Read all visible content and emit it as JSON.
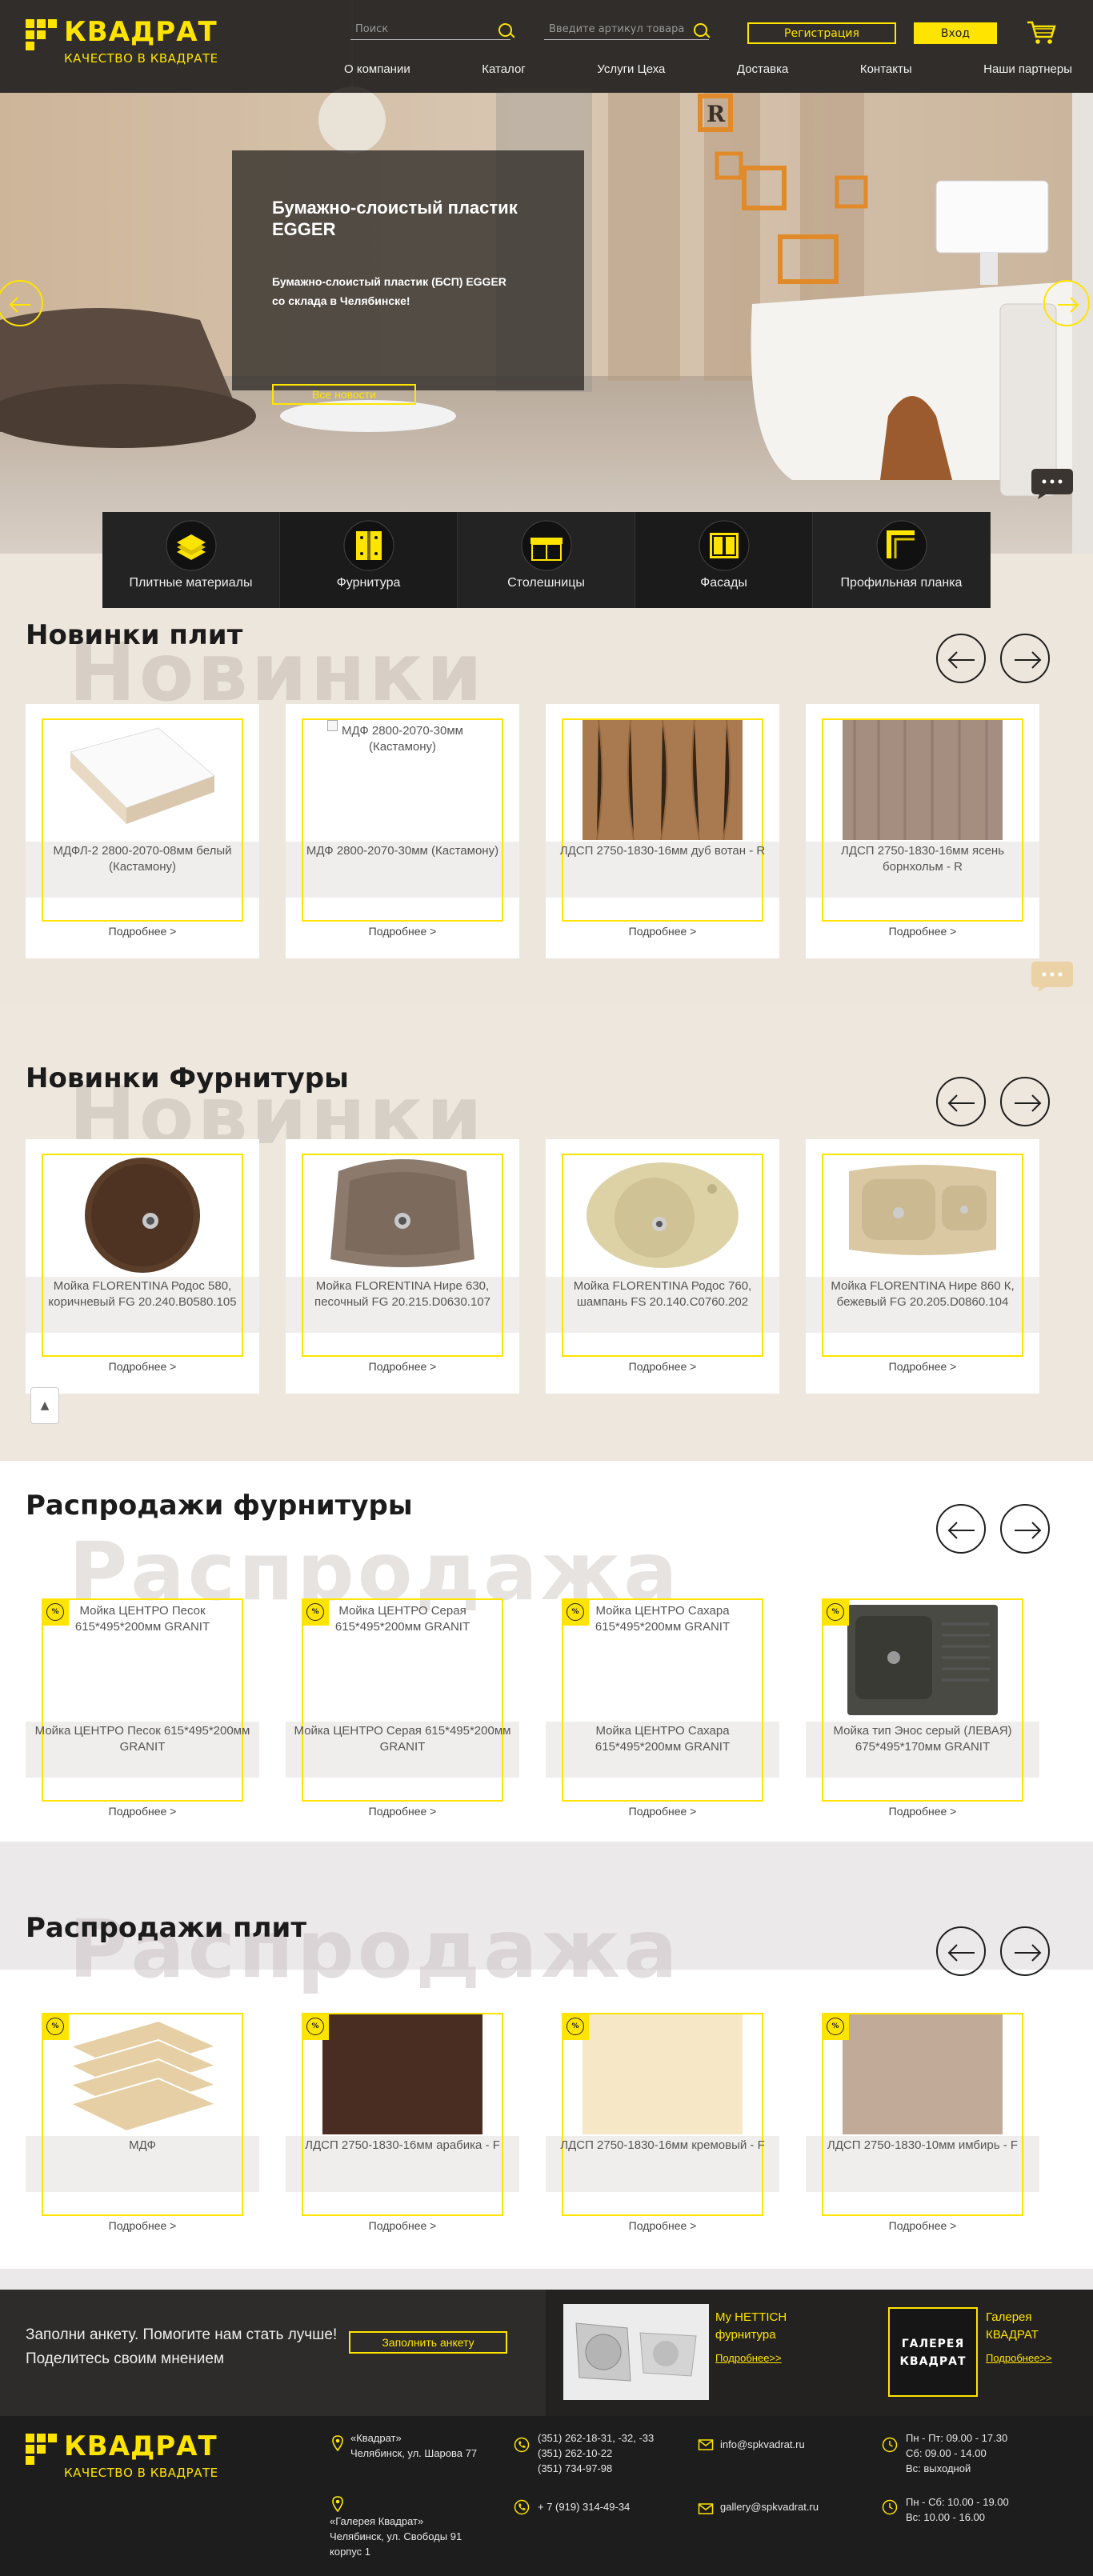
{
  "header": {
    "logo_name": "КВАДРАТ",
    "logo_slogan": "КАЧЕСТВО В КВАДРАТЕ",
    "search_placeholder": "Поиск",
    "article_placeholder": "Введите артикул товара",
    "register_label": "Регистрация",
    "login_label": "Вход",
    "nav": [
      "О компании",
      "Каталог",
      "Услуги Цеха",
      "Доставка",
      "Контакты",
      "Наши партнеры"
    ]
  },
  "hero": {
    "title": "Бумажно-слоистый пластик EGGER",
    "text": "Бумажно-слоистый пластик (БСП) EGGER со склада в Челябинске!",
    "button": "Все новости",
    "sign_letter": "R",
    "chat_label": "···"
  },
  "categories": [
    "Плитные материалы",
    "Фурнитура",
    "Столешницы",
    "Фасады",
    "Профильная планка"
  ],
  "more_label": "Подробнее >",
  "sale_badge_label": "%",
  "up_label": "▲",
  "sections": {
    "new_plates": {
      "title": "Новинки плит",
      "ghost": "Новинки",
      "items": [
        {
          "name": "МДФЛ-2 2800-2070-08мм белый (Кастамону)",
          "caption": ""
        },
        {
          "name": "МДФ 2800-2070-30мм (Кастамону)",
          "caption": "МДФ 2800-2070-30мм (Кастамону)"
        },
        {
          "name": "ЛДСП 2750-1830-16мм дуб вотан - R",
          "caption": ""
        },
        {
          "name": "ЛДСП 2750-1830-16мм ясень борнхольм - R",
          "caption": ""
        }
      ]
    },
    "new_fittings": {
      "title": "Новинки Фурнитуры",
      "ghost": "Новинки",
      "items": [
        {
          "name": "Мойка FLORENTINA Родос 580, коричневый FG 20.240.B0580.105"
        },
        {
          "name": "Мойка FLORENTINA Нире 630, песочный FG 20.215.D0630.107"
        },
        {
          "name": "Мойка FLORENTINA Родос 760, шампань FS 20.140.C0760.202"
        },
        {
          "name": "Мойка FLORENTINA Нире 860 К, бежевый FG 20.205.D0860.104"
        }
      ]
    },
    "sale_fittings": {
      "title": "Распродажи фурнитуры",
      "ghost": "Распродажа",
      "items": [
        {
          "name": "Мойка ЦЕНТРО Песок 615*495*200мм GRANIT",
          "caption": "Мойка ЦЕНТРО Песок 615*495*200мм GRANIT"
        },
        {
          "name": "Мойка ЦЕНТРО Серая 615*495*200мм GRANIT",
          "caption": "Мойка ЦЕНТРО Серая 615*495*200мм GRANIT"
        },
        {
          "name": "Мойка ЦЕНТРО Сахара 615*495*200мм GRANIT",
          "caption": "Мойка ЦЕНТРО Сахара 615*495*200мм GRANIT"
        },
        {
          "name": "Мойка тип Энос серый (ЛЕВАЯ) 675*495*170мм GRANIT",
          "caption": ""
        }
      ]
    },
    "sale_plates": {
      "title": "Распродажи плит",
      "ghost": "Распродажа",
      "items": [
        {
          "name": "МДФ"
        },
        {
          "name": "ЛДСП 2750-1830-16мм арабика - F"
        },
        {
          "name": "ЛДСП 2750-1830-16мм кремовый - F"
        },
        {
          "name": "ЛДСП 2750-1830-10мм имбирь - F"
        }
      ]
    }
  },
  "promo": {
    "survey_text": "Заполни анкету. Помогите нам стать лучше! Поделитесь своим мнением",
    "survey_button": "Заполнить анкету",
    "hettich_title": "My HETTICH фурнитура",
    "hettich_more": "Подробнее>>",
    "gallery_title": "Галерея КВАДРАТ",
    "gallery_more": "Подробнее>>",
    "gallery_logo_top": "ГАЛЕРЕЯ",
    "gallery_logo_bottom": "КВАДРАТ"
  },
  "footer": {
    "logo_name": "КВАДРАТ",
    "logo_slogan": "КАЧЕСТВО В КВАДРАТЕ",
    "address1": [
      "«Квадрат»",
      "Челябинск, ул. Шарова 77"
    ],
    "address2": [
      "«Галерея Квадрат»",
      "Челябинск, ул. Свободы 91",
      "корпус 1"
    ],
    "phones1": [
      "(351) 262-18-31, -32, -33",
      "(351) 262-10-22",
      "(351) 734-97-98"
    ],
    "phones2": [
      "+ 7 (919) 314-49-34"
    ],
    "email1": "info@spkvadrat.ru",
    "email2": "gallery@spkvadrat.ru",
    "hours1": [
      "Пн - Пт: 09.00 - 17.30",
      "Сб: 09.00 - 14.00",
      "Вс: выходной"
    ],
    "hours2": [
      "Пн - Сб: 10.00 - 19.00",
      "Вс: 10.00 - 16.00"
    ]
  },
  "colors": {
    "accent": "#ffe400",
    "dark": "#2e2c2a",
    "footer": "#1d1d1d"
  }
}
